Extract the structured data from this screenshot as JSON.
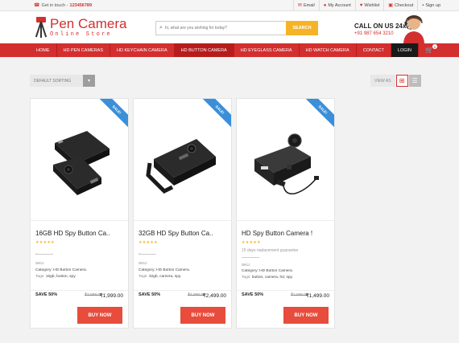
{
  "topbar": {
    "contact_label": "Get in touch -",
    "phone": "123456789",
    "links": [
      "Email",
      "My Account",
      "Wishlist",
      "Checkout",
      "Sign up"
    ]
  },
  "header": {
    "logo_title": "Pen Camera",
    "logo_sub": "Online Store",
    "search_placeholder": "hi, what are you wishing for today?",
    "search_button": "SEARCH",
    "call_label": "CALL ON US 24x7",
    "call_number": "+91 987 654 3210"
  },
  "nav": {
    "items": [
      "HOME",
      "HD PEN CAMERAS",
      "HD KEYCHAIN CAMERA",
      "HD BUTTON CAMERA",
      "HD EYEGLASS CAMERA",
      "HD WATCH CAMERA",
      "CONTACT",
      "LOGIN"
    ],
    "cart_count": "0"
  },
  "toolbar": {
    "sorting": "DEFAULT SORTING",
    "view_as": "VIEW AS"
  },
  "products": [
    {
      "badge": "SALE!",
      "name": "16GB HD Spy Button Ca..",
      "rating": "★★★★★",
      "note": "..",
      "sku_label": "SKU:",
      "category_label": "Category:",
      "category": "HD Button Camera.",
      "tags_label": "Tags:",
      "tags": "16gb, button, spy.",
      "save": "SAVE 50%",
      "old_price": "₹3,998.00",
      "new_price": "₹1,999.00",
      "buy": "BUY NOW"
    },
    {
      "badge": "SALE!",
      "name": "32GB HD Spy Button Ca..",
      "rating": "★★★★★",
      "note": "..",
      "sku_label": "SKU:",
      "category_label": "Category:",
      "category": "HD Button Camera.",
      "tags_label": "Tags:",
      "tags": "32gb, camera, spy.",
      "save": "SAVE 50%",
      "old_price": "₹4,998.00",
      "new_price": "₹2,499.00",
      "buy": "BUY NOW"
    },
    {
      "badge": "SALE!",
      "name": "HD Spy Button Camera !",
      "rating": "★★★★★",
      "note": "15 days replacement guarantee",
      "sku_label": "SKU:",
      "category_label": "Category:",
      "category": "HD Button Camera.",
      "tags_label": "Tags:",
      "tags": "button, camera, hd, spy.",
      "save": "SAVE 50%",
      "old_price": "₹2,998.00",
      "new_price": "₹1,499.00",
      "buy": "BUY NOW"
    }
  ],
  "colors": {
    "brand_red": "#d32f2f",
    "sale_blue": "#3b8fd9",
    "search_yellow": "#f5b427",
    "buy_red": "#e74c3c"
  }
}
